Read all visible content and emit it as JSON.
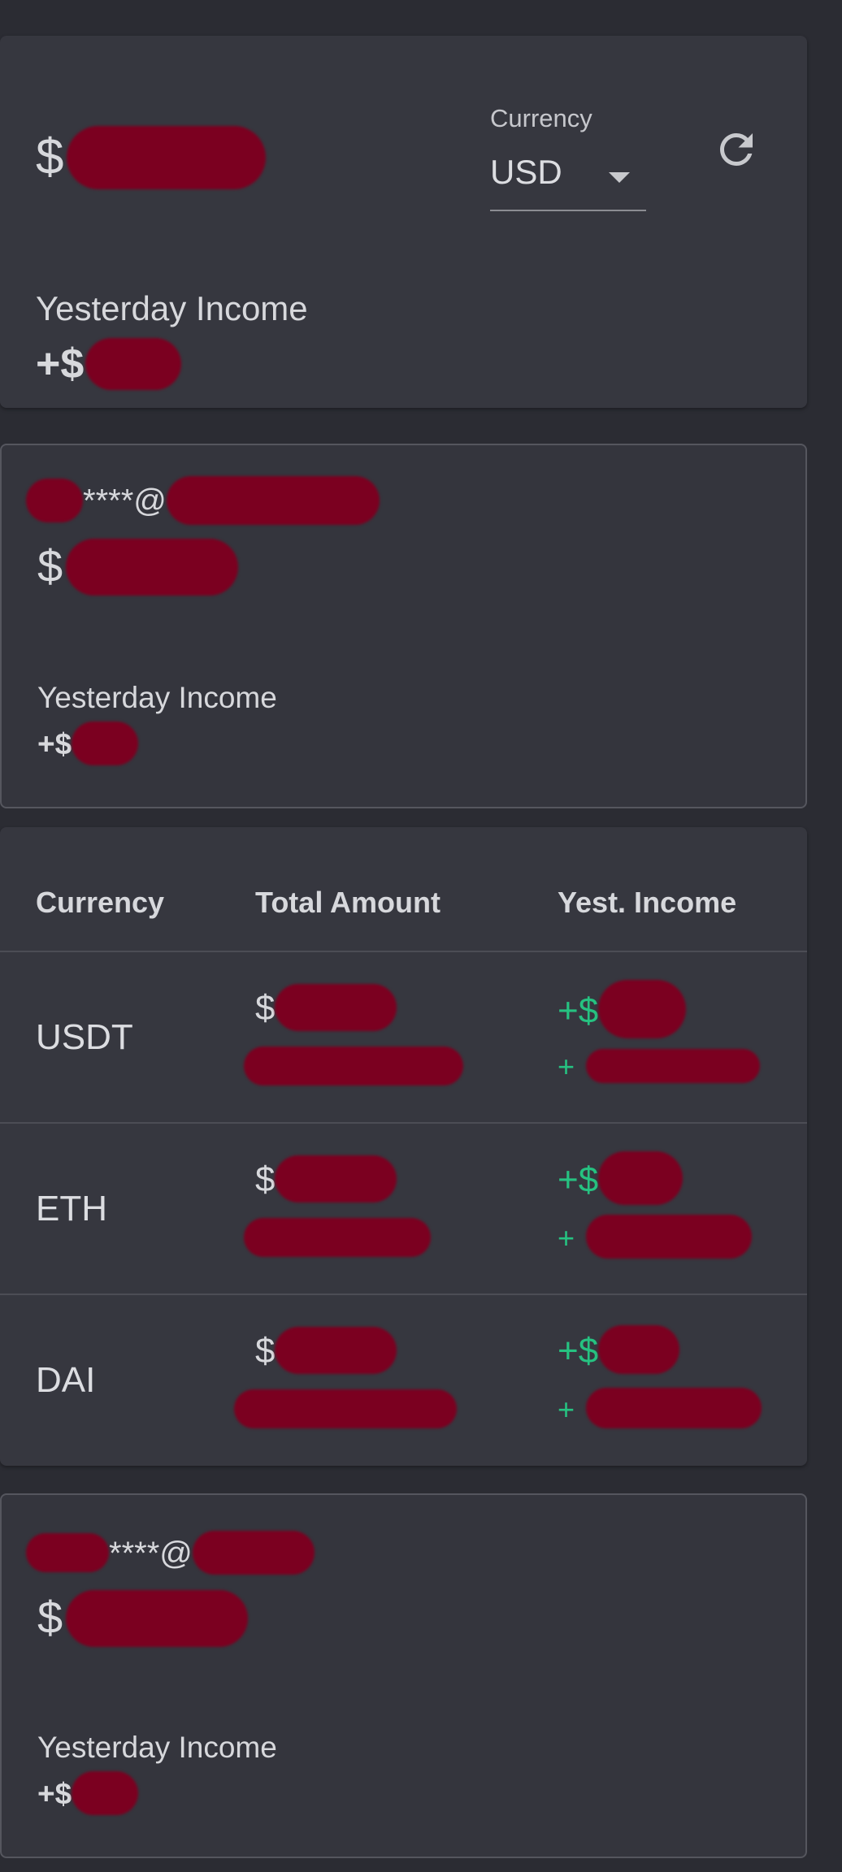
{
  "summary": {
    "amount_prefix": "$",
    "currency_label": "Currency",
    "currency_value": "USD",
    "yesterday_income_label": "Yesterday Income",
    "yesterday_income_prefix": "+$"
  },
  "accounts": [
    {
      "email_masked": "****@",
      "amount_prefix": "$",
      "yesterday_income_label": "Yesterday Income",
      "yesterday_income_prefix": "+$"
    },
    {
      "email_masked": "****@",
      "amount_prefix": "$",
      "yesterday_income_label": "Yesterday Income",
      "yesterday_income_prefix": "+$"
    }
  ],
  "table": {
    "headers": [
      "Currency",
      "Total Amount",
      "Yest. Income"
    ],
    "rows": [
      {
        "currency": "USDT",
        "amount_prefix": "$",
        "income_prefix": "+$",
        "income_sub_prefix": "+"
      },
      {
        "currency": "ETH",
        "amount_prefix": "$",
        "income_prefix": "+$",
        "income_sub_prefix": "+"
      },
      {
        "currency": "DAI",
        "amount_prefix": "$",
        "income_prefix": "+$",
        "income_sub_prefix": "+"
      }
    ]
  },
  "colors": {
    "background": "#2b2c33",
    "card": "#36373f",
    "positive": "#26c281",
    "redaction": "#7b0020"
  },
  "icons": {
    "refresh": "refresh-icon",
    "dropdown": "chevron-down-icon"
  }
}
